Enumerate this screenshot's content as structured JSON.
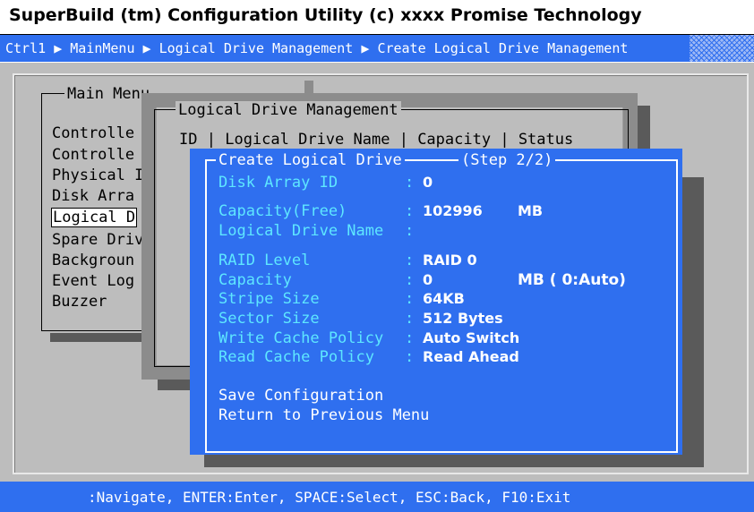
{
  "title": "SuperBuild (tm) Configuration Utility (c) xxxx Promise Technology",
  "breadcrumb": [
    "Ctrl1",
    "MainMenu",
    "Logical Drive Management",
    "Create Logical Drive Management"
  ],
  "breadcrumb_separator_icon": "right-triangle-icon",
  "main_menu": {
    "title": "Main Menu",
    "items": [
      "Controlle",
      "Controlle",
      "Physical I",
      "Disk Arra",
      "Logical D",
      "Spare Driv",
      "Backgroun",
      "Event Log",
      "Buzzer"
    ],
    "selected_index": 4
  },
  "logical_drive_management": {
    "title": "Logical Drive Management",
    "columns": [
      "ID",
      "Logical Drive Name",
      "Capacity",
      "Status"
    ]
  },
  "create_logical_drive": {
    "title": "Create Logical Drive",
    "step": "(Step 2/2)",
    "fields": [
      {
        "label": "Disk Array ID",
        "value": "0"
      },
      {
        "label": "Capacity(Free)",
        "value": "102996",
        "unit": "MB"
      },
      {
        "label": "Logical Drive Name",
        "value": ""
      },
      {
        "label": "RAID Level",
        "value": "RAID 0"
      },
      {
        "label": "Capacity",
        "value": "0",
        "unit": "MB ( 0:Auto)"
      },
      {
        "label": "Stripe Size",
        "value": "64KB"
      },
      {
        "label": "Sector Size",
        "value": "512 Bytes"
      },
      {
        "label": "Write Cache Policy",
        "value": "Auto Switch"
      },
      {
        "label": "Read Cache Policy",
        "value": "Read Ahead"
      }
    ],
    "actions": [
      "Save Configuration",
      "Return to Previous Menu"
    ]
  },
  "status_bar": ":Navigate, ENTER:Enter, SPACE:Select, ESC:Back, F10:Exit",
  "colors": {
    "accent_blue": "#2f6fef",
    "label_cyan": "#5ee7ff",
    "panel_gray": "#bdbdbd"
  }
}
